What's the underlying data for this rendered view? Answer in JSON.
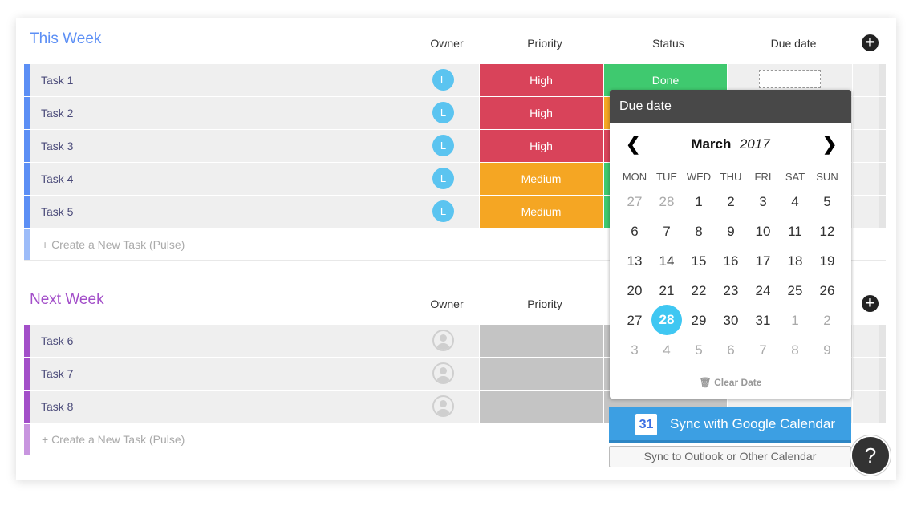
{
  "groups": [
    {
      "title": "This Week",
      "color": "#5c8ff5",
      "columns": {
        "owner": "Owner",
        "priority": "Priority",
        "status": "Status",
        "due": "Due date"
      },
      "tasks": [
        {
          "name": "Task 1",
          "owner": "L",
          "priority": "High",
          "priority_color": "#d9435a",
          "status": "Done",
          "status_color": "#3fc96f"
        },
        {
          "name": "Task 2",
          "owner": "L",
          "priority": "High",
          "priority_color": "#d9435a",
          "status": "",
          "status_color": "#f5a623"
        },
        {
          "name": "Task 3",
          "owner": "L",
          "priority": "High",
          "priority_color": "#d9435a",
          "status": "",
          "status_color": "#d9435a"
        },
        {
          "name": "Task 4",
          "owner": "L",
          "priority": "Medium",
          "priority_color": "#f5a623",
          "status": "",
          "status_color": "#3fc96f"
        },
        {
          "name": "Task 5",
          "owner": "L",
          "priority": "Medium",
          "priority_color": "#f5a623",
          "status": "",
          "status_color": "#3fc96f"
        }
      ],
      "create_label": "+ Create a New Task (Pulse)"
    },
    {
      "title": "Next Week",
      "color": "#a34fc9",
      "columns": {
        "owner": "Owner",
        "priority": "Priority"
      },
      "tasks": [
        {
          "name": "Task 6",
          "owner": "",
          "priority": "",
          "priority_color": "#c4c4c4",
          "status": "",
          "status_color": "#c4c4c4"
        },
        {
          "name": "Task 7",
          "owner": "",
          "priority": "",
          "priority_color": "#c4c4c4",
          "status": "",
          "status_color": "#c4c4c4"
        },
        {
          "name": "Task 8",
          "owner": "",
          "priority": "",
          "priority_color": "#c4c4c4",
          "status": "",
          "status_color": "#c4c4c4"
        }
      ],
      "create_label": "+ Create a New Task (Pulse)"
    }
  ],
  "datepicker": {
    "title": "Due date",
    "month": "March",
    "year": "2017",
    "weekdays": [
      "MON",
      "TUE",
      "WED",
      "THU",
      "FRI",
      "SAT",
      "SUN"
    ],
    "weeks": [
      [
        "27",
        "28",
        "1",
        "2",
        "3",
        "4",
        "5"
      ],
      [
        "6",
        "7",
        "8",
        "9",
        "10",
        "11",
        "12"
      ],
      [
        "13",
        "14",
        "15",
        "16",
        "17",
        "18",
        "19"
      ],
      [
        "20",
        "21",
        "22",
        "23",
        "24",
        "25",
        "26"
      ],
      [
        "27",
        "28",
        "29",
        "30",
        "31",
        "1",
        "2"
      ],
      [
        "3",
        "4",
        "5",
        "6",
        "7",
        "8",
        "9"
      ]
    ],
    "selected": "28",
    "clear_label": "Clear Date",
    "google_label": "Sync with Google Calendar",
    "google_icon_text": "31",
    "outlook_label": "Sync to Outlook or Other Calendar"
  },
  "help_label": "?",
  "accent": "#3c9fe3"
}
